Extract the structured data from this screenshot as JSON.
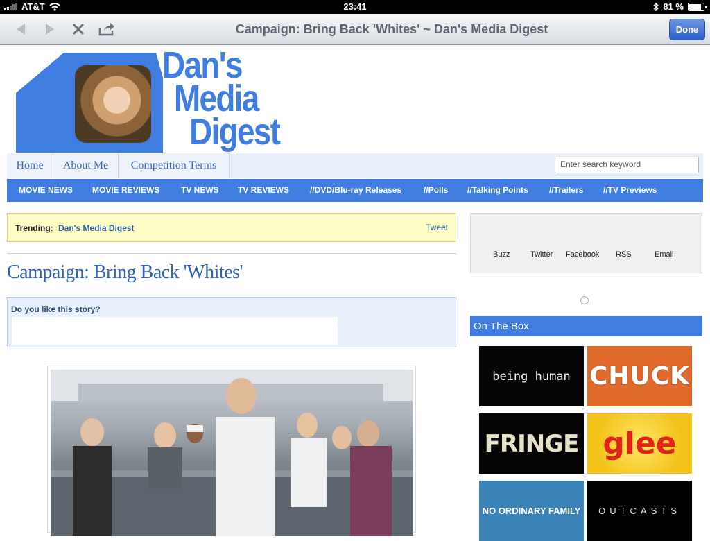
{
  "status_bar": {
    "carrier": "AT&T",
    "time": "23:41",
    "battery": "81 %"
  },
  "toolbar": {
    "title": "Campaign: Bring Back 'Whites' ~ Dan's Media Digest",
    "done_label": "Done"
  },
  "logo": {
    "line1": "Dan's",
    "line2": "Media",
    "line3": "Digest"
  },
  "top_nav": {
    "items": [
      "Home",
      "About Me",
      "Competition Terms"
    ],
    "search_placeholder": "Enter search keyword"
  },
  "category_nav": {
    "items": [
      "MOVIE NEWS",
      "MOVIE REVIEWS",
      "TV NEWS",
      "TV REVIEWS",
      "//DVD/Blu-ray Releases",
      "//Polls",
      "//Talking Points",
      "//Trailers",
      "//TV Previews"
    ]
  },
  "trending": {
    "label": "Trending:",
    "value": "Dan's Media Digest",
    "tweet": "Tweet"
  },
  "article": {
    "headline": "Campaign: Bring Back 'Whites'",
    "like_question": "Do you like this story?"
  },
  "share": {
    "items": [
      "Buzz",
      "Twitter",
      "Facebook",
      "RSS",
      "Email"
    ]
  },
  "on_the_box": {
    "title": "On The Box",
    "shows": [
      "being human",
      "CHUCK",
      "FRINGE",
      "glee",
      "NO ORDINARY FAMILY",
      "OUTCASTS"
    ]
  },
  "colors": {
    "brand_blue": "#3f7de0",
    "trending_bg": "#fefcc6",
    "link_blue": "#2e5fa9"
  }
}
